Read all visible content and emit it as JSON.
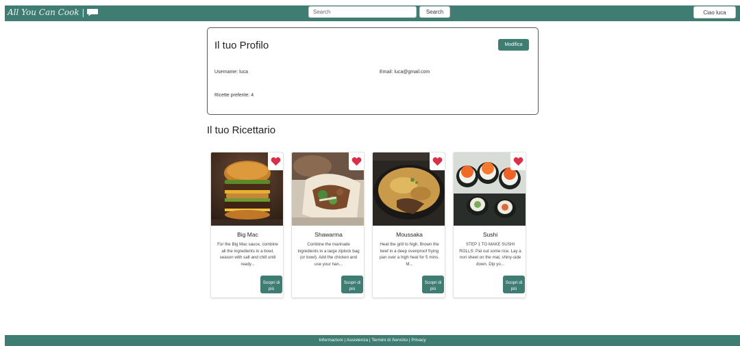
{
  "app": {
    "brand": "All You Can Cook |"
  },
  "header": {
    "search_placeholder": "Search",
    "search_button": "Search",
    "user_button": "Ciao luca"
  },
  "profile": {
    "title": "Il tuo Profilo",
    "edit_button": "Modifica",
    "username": "Username: luca",
    "email": "Email: luca@gmail.com",
    "favorites": "Ricette preferite: 4"
  },
  "cookbook": {
    "title": "Il tuo Ricettario",
    "recipes": [
      {
        "name": "Big Mac",
        "description": "For the Big Mac sauce, combine all the ingredients in a bowl, season with salt and chill until ready...",
        "button": "Scopri di più",
        "favorite_icon": "heart-icon"
      },
      {
        "name": "Shawarma",
        "description": "Combine the marinade ingredients in a large ziplock bag (or bowl). Add the chicken and use your han...",
        "button": "Scopri di più",
        "favorite_icon": "heart-icon"
      },
      {
        "name": "Moussaka",
        "description": "Heat the grill to high. Brown the beef in a deep ovenproof frying pan over a high heat for 5 mins. M...",
        "button": "Scopri di più",
        "favorite_icon": "heart-icon"
      },
      {
        "name": "Sushi",
        "description": "STEP 1 TO MAKE SUSHI ROLLS: Pat out some rice. Lay a nori sheet on the mat, shiny-side down. Dip yo...",
        "button": "Scopri di più",
        "favorite_icon": "heart-icon"
      }
    ]
  },
  "footer": {
    "link_info": "Informazioni",
    "link_help": "Assistenza",
    "link_terms": "Termini di Servizio",
    "link_privacy": "Privacy",
    "separator": " | "
  },
  "colors": {
    "primary": "#3f7c72",
    "heart": "#d9304a"
  }
}
